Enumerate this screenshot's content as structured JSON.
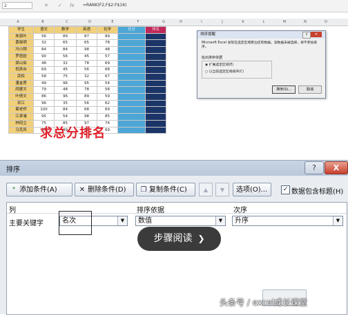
{
  "excel": {
    "namebox": "2",
    "formula": "=RANK(F2,F$2:F$16)",
    "col_letters": [
      "A",
      "B",
      "C",
      "D",
      "E",
      "F",
      "G",
      "H",
      "I",
      "J",
      "K",
      "L",
      "M",
      "N",
      "O"
    ],
    "headers": [
      "学生",
      "语文",
      "数学",
      "英语",
      "化学",
      "总分",
      "排名"
    ],
    "rows": [
      [
        "朱丽叶",
        "56",
        "89",
        "87",
        "89",
        "",
        ""
      ],
      [
        "黄晓明",
        "32",
        "65",
        "65",
        "78",
        "",
        ""
      ],
      [
        "冯小刚",
        "84",
        "84",
        "98",
        "48",
        "",
        ""
      ],
      [
        "罗密欧",
        "90",
        "56",
        "45",
        "57",
        "",
        ""
      ],
      [
        "梁山伯",
        "48",
        "32",
        "78",
        "69",
        "",
        ""
      ],
      [
        "祝英台",
        "69",
        "45",
        "56",
        "68",
        "",
        ""
      ],
      [
        "武松",
        "58",
        "75",
        "32",
        "67",
        "",
        ""
      ],
      [
        "潘金莲",
        "49",
        "96",
        "95",
        "54",
        "",
        ""
      ],
      [
        "阎婆文",
        "79",
        "48",
        "78",
        "58",
        "",
        ""
      ],
      [
        "叶倩文",
        "86",
        "96",
        "89",
        "59",
        "",
        ""
      ],
      [
        "宋江",
        "96",
        "35",
        "56",
        "62",
        "",
        ""
      ],
      [
        "葛老师",
        "100",
        "84",
        "68",
        "69",
        "",
        ""
      ],
      [
        "江承浦",
        "95",
        "54",
        "98",
        "85",
        "",
        ""
      ],
      [
        "林倪立",
        "75",
        "85",
        "97",
        "74",
        "",
        ""
      ],
      [
        "马克风",
        "65",
        "49",
        "58",
        "69",
        "",
        ""
      ]
    ],
    "caption": "求总分排名"
  },
  "small_dialog": {
    "title": "排序提醒",
    "message": "Microsoft Excel 发现在选定区域旁边还有数据。该数据未被选择，将不参加排序。",
    "subtitle": "给出排序依据",
    "option1": "扩展选定区域(E)",
    "option2": "以当前选定区域排序(C)",
    "ok": "排序(S)...",
    "cancel": "取消"
  },
  "sort_dialog": {
    "title": "排序",
    "help": "?",
    "close": "X",
    "add": "添加条件(A)",
    "delete": "删除条件(D)",
    "copy": "复制条件(C)",
    "options": "选项(O)...",
    "has_headers_label": "数据包含标题(H)",
    "has_headers_checked": "✓",
    "col_header": "列",
    "sort_on_header": "排序依据",
    "order_header": "次序",
    "main_key_label": "主要关键字",
    "column_value": "名次",
    "sort_on_value": "数值",
    "order_value": "升序"
  },
  "overlay": {
    "pill": "步骤阅读",
    "watermark": "头条号 / excel成长课堂"
  }
}
